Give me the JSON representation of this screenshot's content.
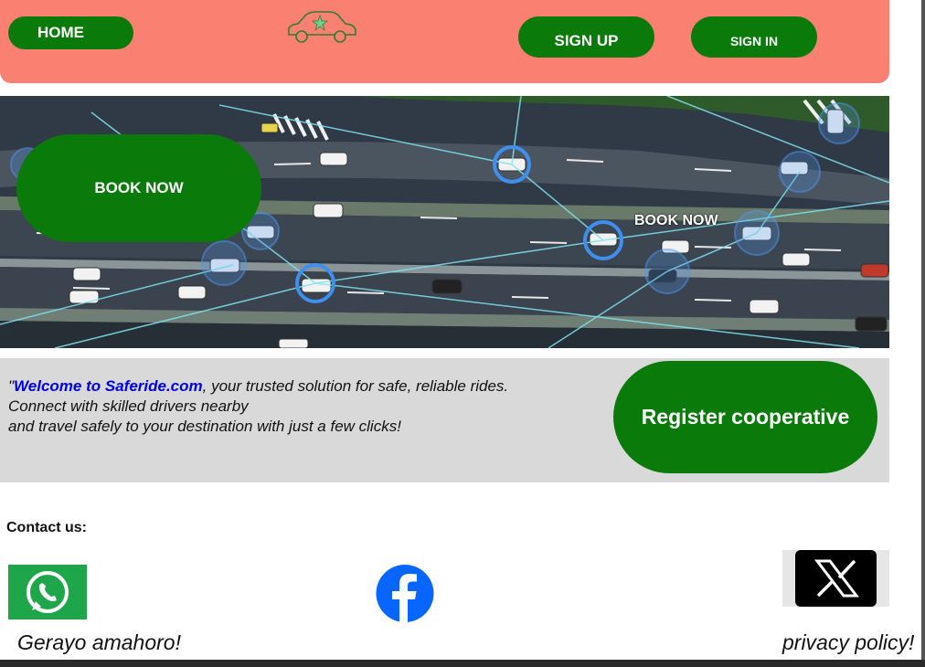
{
  "header": {
    "home_label": "HOME",
    "signup_label": "SIGN UP",
    "signin_label": "SIGN IN",
    "logo_icon": "car-icon",
    "background_color": "#fa8072",
    "button_color": "#0a7a0a"
  },
  "hero": {
    "book_now_label": "BOOK NOW",
    "book_now_small_label": "BOOK NOW",
    "image_description_icon": "highway-traffic-image"
  },
  "welcome": {
    "quote_open": "\"",
    "brand": "Welcome to Saferide.com",
    "line1_rest": ", your trusted solution for safe, reliable rides.",
    "line2": "Connect with skilled drivers nearby",
    "line3": "and travel safely to your destination with just a few clicks!",
    "brand_color": "#0000ee",
    "register_label": "Register cooperative"
  },
  "footer": {
    "contact_label": "Contact  us:",
    "whatsapp_icon": "whatsapp-icon",
    "facebook_icon": "facebook-icon",
    "x_icon": "x-icon",
    "slogan": "Gerayo amahoro!",
    "privacy_label": "privacy policy!"
  }
}
